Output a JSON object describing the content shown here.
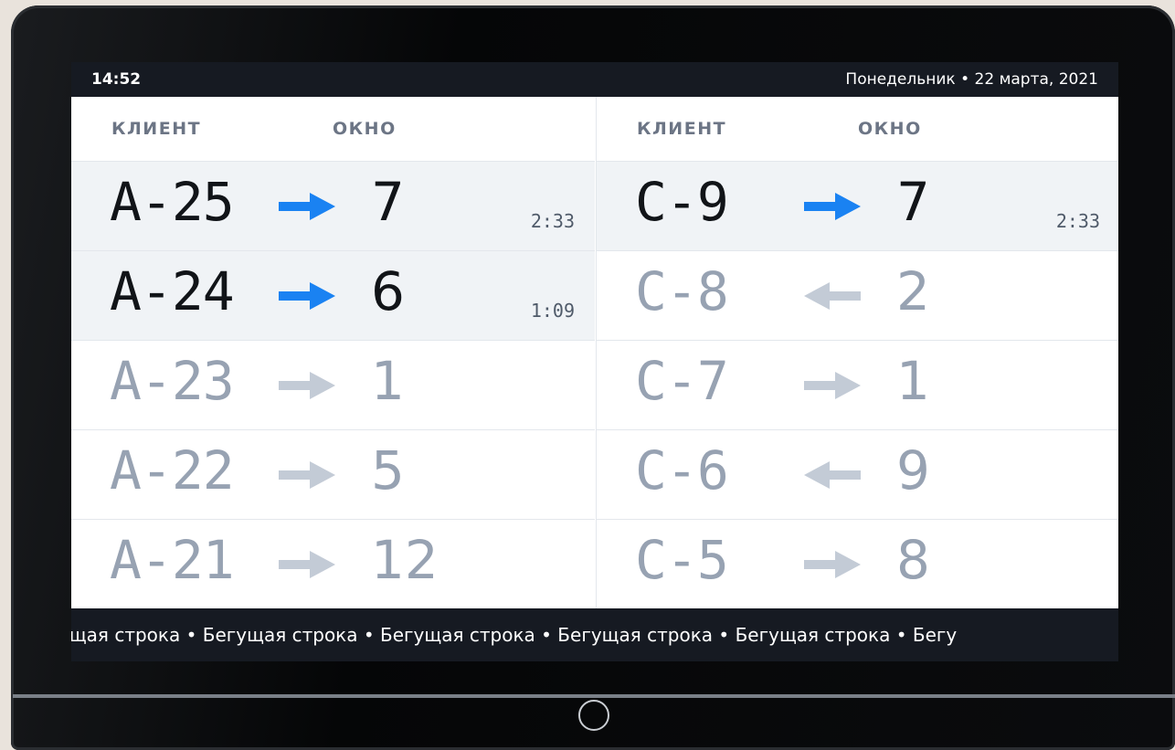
{
  "status": {
    "time": "14:52",
    "date": "Понедельник  •  22 марта, 2021"
  },
  "headers": {
    "client": "КЛИЕНТ",
    "window": "ОКНО"
  },
  "queues": {
    "left": [
      {
        "ticket": "A-25",
        "window": "7",
        "direction": "right",
        "active": true,
        "timer": "2:33"
      },
      {
        "ticket": "A-24",
        "window": "6",
        "direction": "right",
        "active": true,
        "timer": "1:09"
      },
      {
        "ticket": "A-23",
        "window": "1",
        "direction": "right",
        "active": false,
        "timer": ""
      },
      {
        "ticket": "A-22",
        "window": "5",
        "direction": "right",
        "active": false,
        "timer": ""
      },
      {
        "ticket": "A-21",
        "window": "12",
        "direction": "right",
        "active": false,
        "timer": ""
      }
    ],
    "right": [
      {
        "ticket": "C-9",
        "window": "7",
        "direction": "right",
        "active": true,
        "timer": "2:33"
      },
      {
        "ticket": "C-8",
        "window": "2",
        "direction": "left",
        "active": false,
        "timer": ""
      },
      {
        "ticket": "C-7",
        "window": "1",
        "direction": "right",
        "active": false,
        "timer": ""
      },
      {
        "ticket": "C-6",
        "window": "9",
        "direction": "left",
        "active": false,
        "timer": ""
      },
      {
        "ticket": "C-5",
        "window": "8",
        "direction": "right",
        "active": false,
        "timer": ""
      }
    ]
  },
  "ticker": {
    "text": "ущая строка  •  Бегущая строка  •  Бегущая строка  •  Бегущая строка  •  Бегущая строка  •  Бегу"
  },
  "colors": {
    "arrow_active": "#1a82f2",
    "arrow_inactive": "#c3cbd6"
  }
}
